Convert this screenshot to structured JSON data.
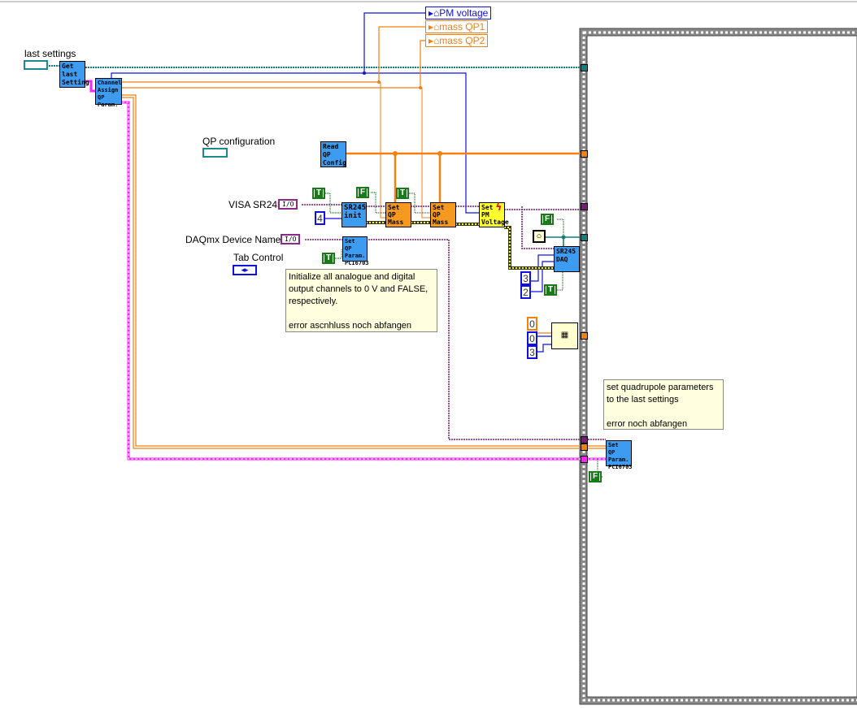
{
  "controls": {
    "last_settings": "last settings",
    "qp_configuration": "QP configuration",
    "visa_sr245": "VISA SR245",
    "daqmx_device_name": "DAQmx Device Name",
    "tab_control": "Tab Control"
  },
  "indicators": {
    "pm_voltage": "PM voltage",
    "mass_qp1": "mass QP1",
    "mass_qp2": "mass QP2"
  },
  "nodes": {
    "get_last_setting": [
      "Get",
      "last",
      "Setting"
    ],
    "channel_assign": [
      "Channel",
      "Assign",
      "QP",
      "Param."
    ],
    "read_qp_config": [
      "Read",
      "QP",
      "Config"
    ],
    "sr245_init": [
      "SR245",
      "init"
    ],
    "set_qp_mass_1": [
      "Set",
      "QP",
      "Mass"
    ],
    "set_qp_mass_2": [
      "Set",
      "QP",
      "Mass"
    ],
    "set_pm_voltage": [
      "Set",
      "PM",
      "Voltage"
    ],
    "set_qp_param_1": [
      "Set",
      "QP",
      "Param.",
      "PCI6703"
    ],
    "sr245_daq": [
      "SR245",
      "DAQ"
    ],
    "set_qp_param_2": [
      "Set",
      "QP",
      "Param.",
      "PCI6703"
    ]
  },
  "constants": {
    "t1": "T",
    "f1": "F",
    "t2": "T",
    "t3": "T",
    "f2": "F",
    "t4": "T",
    "f3": "F",
    "n4": "4",
    "n3": "3",
    "n2": "2",
    "o0": "0",
    "b0": "0",
    "b3": "3",
    "io1": "I/O",
    "io2": "I/O"
  },
  "comments": {
    "init": "Initialize all analogue and digital\noutput channels to 0 V and FALSE,\nrespectively.\n\nerror ascnhluss noch abfangen",
    "set_qp": "set quadrupole parameters\nto the last settings\n\nerror noch abfangen"
  },
  "colors": {
    "orange": "#f08010",
    "blue": "#1010e0",
    "teal": "#107f7f",
    "purple": "#7a1a7a",
    "pink": "#ff20ff",
    "green": "#1a7a1a"
  }
}
